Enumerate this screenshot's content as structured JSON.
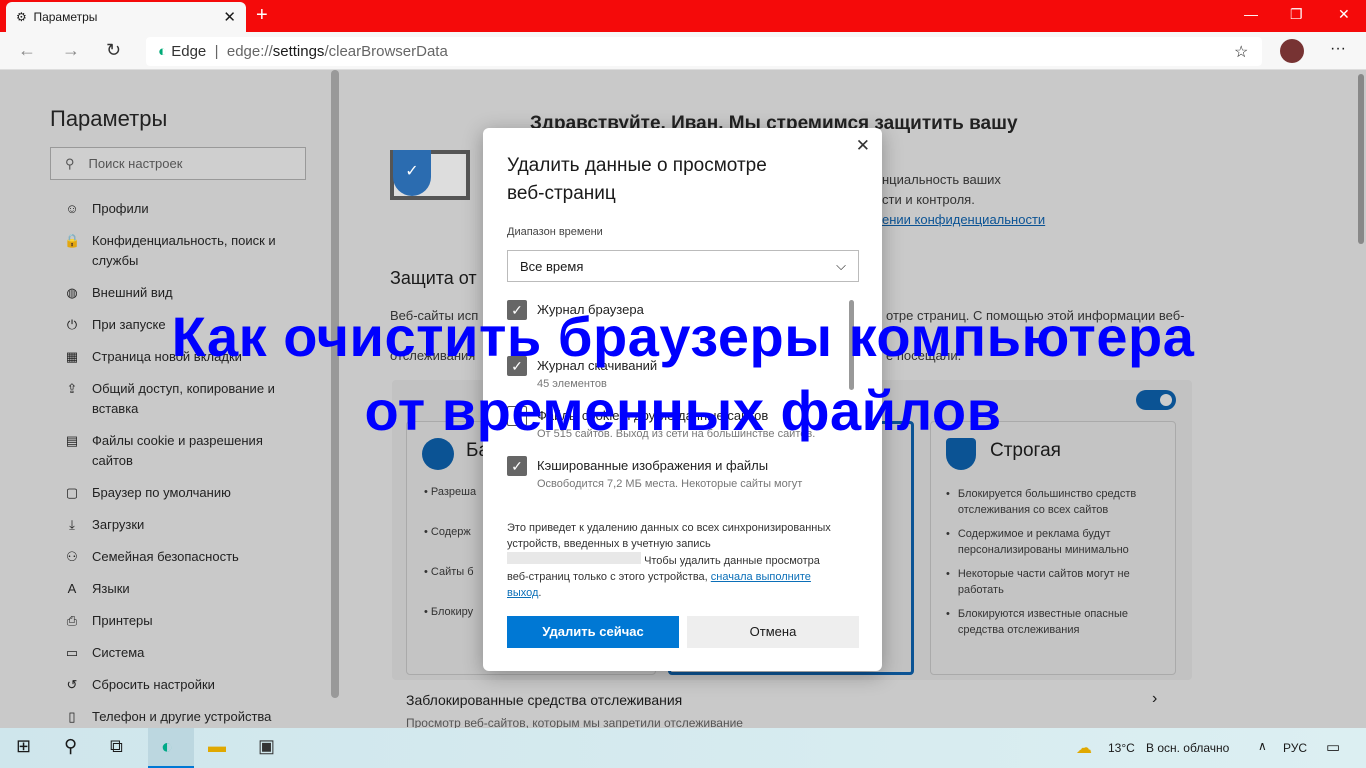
{
  "browser": {
    "tab_title": "Параметры",
    "url_brand": "Edge",
    "url_prefix": "edge://",
    "url_path": "settings",
    "url_rest": "/clearBrowserData"
  },
  "sidebar": {
    "title": "Параметры",
    "search_placeholder": "Поиск настроек",
    "items": [
      {
        "label": "Профили",
        "icon": "profile-icon"
      },
      {
        "label": "Конфиденциальность, поиск и службы",
        "icon": "lock-icon"
      },
      {
        "label": "Внешний вид",
        "icon": "palette-icon"
      },
      {
        "label": "При запуске",
        "icon": "power-icon"
      },
      {
        "label": "Страница новой вкладки",
        "icon": "new-tab-icon"
      },
      {
        "label": "Общий доступ, копирование и вставка",
        "icon": "share-icon"
      },
      {
        "label": "Файлы cookie и разрешения сайтов",
        "icon": "cookie-icon"
      },
      {
        "label": "Браузер по умолчанию",
        "icon": "browser-icon"
      },
      {
        "label": "Загрузки",
        "icon": "download-icon"
      },
      {
        "label": "Семейная безопасность",
        "icon": "family-icon"
      },
      {
        "label": "Языки",
        "icon": "language-icon"
      },
      {
        "label": "Принтеры",
        "icon": "printer-icon"
      },
      {
        "label": "Система",
        "icon": "system-icon"
      },
      {
        "label": "Сбросить настройки",
        "icon": "reset-icon"
      },
      {
        "label": "Телефон и другие устройства",
        "icon": "phone-icon"
      }
    ]
  },
  "main": {
    "greeting": "Здравствуйте, Иван. Мы стремимся защитить вашу",
    "greeting_l2": "нциальность ваших",
    "greeting_l3": "сти и контроля.",
    "privacy_link": "ении конфиденциальности",
    "section_title": "Защита от",
    "section_desc_l1": "Веб-сайты исп",
    "section_desc_l1b": "отре страниц. С помощью этой информации веб-",
    "section_desc_l3": "отслеживания",
    "section_desc_l3b": "е посещали.",
    "card_basic": "Ба",
    "card_basic_items": [
      "Разреша",
      "Содерж",
      "Сайты б",
      "Блокиру"
    ],
    "card_strict": {
      "title": "Строгая",
      "items": [
        "Блокируется большинство средств отслеживания со всех сайтов",
        "Содержимое и реклама будут персонализированы минимально",
        "Некоторые части сайтов могут не работать",
        "Блокируются известные опасные средства отслеживания"
      ]
    },
    "blocked_title": "Заблокированные средства отслеживания",
    "blocked_desc": "Просмотр веб-сайтов, которым мы запретили отслеживание"
  },
  "dialog": {
    "title_l1": "Удалить данные о просмотре",
    "title_l2": "веб-страниц",
    "range_label": "Диапазон времени",
    "range_value": "Все время",
    "options": [
      {
        "label": "Журнал браузера",
        "sub": "",
        "checked": true
      },
      {
        "label": "Журнал скачиваний",
        "sub": "45 элементов",
        "checked": true
      },
      {
        "label": "Файлы cookie и другие данные сайтов",
        "sub": "От 515 сайтов. Выход из сети на большинстве сайтов.",
        "checked": false
      },
      {
        "label": "Кэшированные изображения и файлы",
        "sub": "Освободится 7,2 МБ места. Некоторые сайты могут",
        "checked": true
      }
    ],
    "note_l1": "Это приведет к удалению данных со всех синхронизированных",
    "note_l2": "устройств, введенных в учетную запись",
    "note_l3": "Чтобы удалить данные просмотра",
    "note_l4": "веб-страниц только с этого устройства,",
    "note_link1": "сначала выполните",
    "note_link2": "выход",
    "delete_button": "Удалить сейчас",
    "cancel_button": "Отмена"
  },
  "overlay": {
    "line1": "Как очистить браузеры компьютера",
    "line2": "от временных файлов",
    "color": "#0000ff"
  },
  "taskbar": {
    "weather": "13°C",
    "weather_desc": "В осн. облачно",
    "lang": "РУС"
  },
  "colors": {
    "accent": "#0078d4",
    "tabbar": "#f50a0a"
  }
}
